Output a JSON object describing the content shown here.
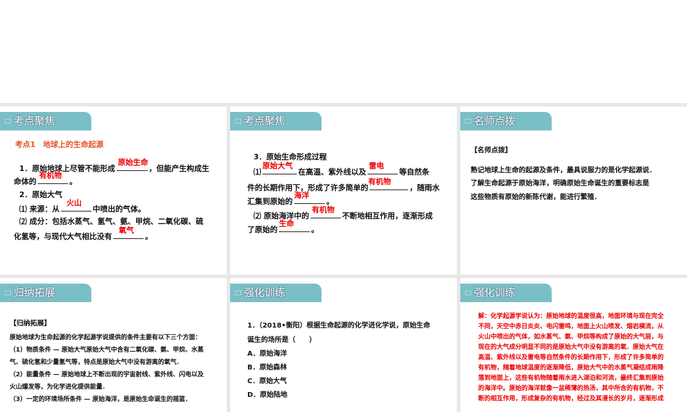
{
  "p1": {
    "tab": "考点聚焦",
    "heading": "考点1　地球上的生命起源",
    "l1a": "1．原始地球上尽管不能形成",
    "a1": "原始生命",
    "l1b": "，但能产生构成生",
    "l2a": "命体的",
    "a2": "有机物",
    "l2b": "。",
    "l3": "2．原始大气",
    "l4a": "⑴ 来源：从",
    "a3": "火山",
    "l4b": "中喷出的气体。",
    "l5": "⑵ 成分：包括水蒸气、氢气、氨、甲烷、二氧化碳、硫",
    "l6a": "化氢等，与现代大气相比没有",
    "a4": "氧气",
    "l6b": "。"
  },
  "p2": {
    "tab": "考点聚焦",
    "l1": "3．原始生命形成过程",
    "l2a": "⑴",
    "a1": "原始大气",
    "l2b": "在高温、紫外线以及",
    "a2": "雷电",
    "l2c": "等自然条",
    "l3a": "件的长期作用下，形成了许多简单的",
    "a3": "有机物",
    "l3b": "，随雨水",
    "l4a": "汇集到原始的",
    "a4": "海洋",
    "l4b": "。",
    "l5a": "⑵ 原始海洋中的",
    "a5": "有机物",
    "l5b": "不断地相互作用，逐渐形成",
    "l6a": "了原始的",
    "a6": "生命",
    "l6b": "。"
  },
  "p3": {
    "tab": "名师点拨",
    "heading": "【名师点拨】",
    "lines": [
      "熟记地球上生命的起源及条件，最具说服力的是化学起源说．",
      "了解生命起源于原始海洋，明确原始生命诞生的重要标志是",
      "这些物质有原始的新陈代谢，能进行繁殖．"
    ]
  },
  "p4": {
    "tab": "归纳拓展",
    "heading": "【归纳拓展】",
    "lines": [
      "原始地球为生命起源的化学起源学说提供的条件主要有以下三个方面：",
      "（1）物质条件 — 原始大气原始大气中含有二氧化碳、氨、甲烷、水蒸",
      "气、硫化氢和少量氢气等，特点是原始大气中没有游离的氧气．",
      "（2）能量条件 — 原始地球上不断出现的宇宙射线、紫外线、闪电以及",
      "火山爆发等，为化学进化提供能量．",
      "（3）一定的环境场所条件 — 原始海洋，是原始生命诞生的摇篮．"
    ]
  },
  "p5": {
    "tab": "强化训练",
    "q1": "1．（2018•衡阳）根据生命起源的化学进化学说，原始生命",
    "q2": "诞生的场所是（　　）",
    "options": [
      "A．原始海洋",
      "B．原始森林",
      "C．原始大气",
      "D．原始陆地"
    ]
  },
  "p6": {
    "tab": "强化训练",
    "lines": [
      "解：化学起源学说认为：原始地球的温度很高，地面环境与现在完全",
      "不同，天空中赤日炎炎、电闪雷鸣，地面上火山喷发、熔岩横流，从",
      "火山中喷出的气体，如水蒸气、氨、甲烷等构成了原始的大气层，与",
      "现在的大气成分明显不同的是原始大气中没有游离的氧．原始大气在",
      "高温、紫外线以及雷电等自然条件的长期作用下，形成了许多简单的",
      "有机物，随着地球温度的逐渐降低，原始大气中的水蒸气凝结成雨降",
      "落到地面上，这些有机物随着雨水进入湖泊和河流，最终汇集到原始",
      "的海洋中。原始的海洋就像一盆稀薄的热汤，其中所含的有机物，不",
      "断的相互作用，形成复杂的有机物，经过及其漫长的岁月，逐渐形成"
    ]
  }
}
